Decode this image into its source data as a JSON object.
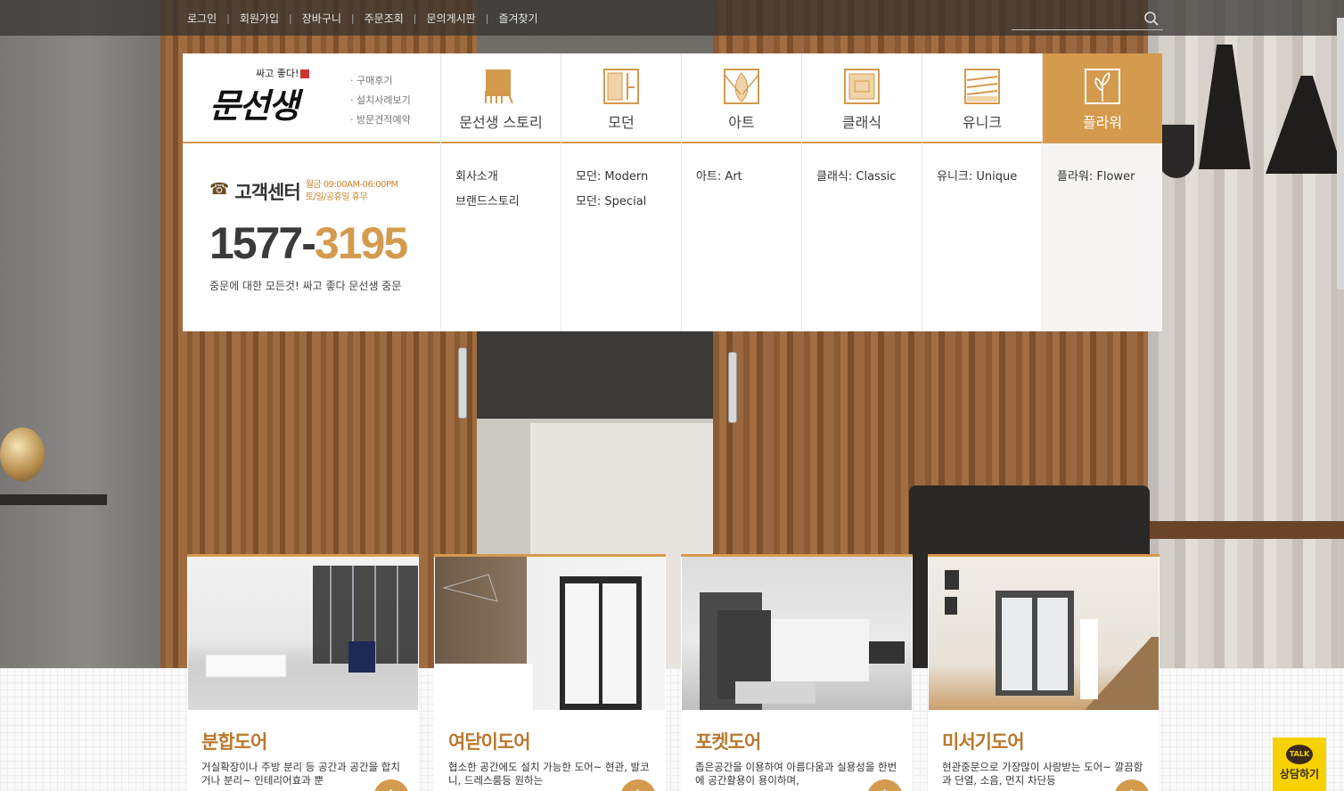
{
  "top_links": [
    "로그인",
    "회원가입",
    "장바구니",
    "주문조회",
    "문의게시판",
    "즐겨찾기"
  ],
  "search": {
    "placeholder": ""
  },
  "logo": {
    "tagline": "싸고 좋다!",
    "brand": "문선생"
  },
  "sublinks": [
    "· 구매후기",
    "· 설치사례보기",
    "· 방문견적예약"
  ],
  "menu": [
    {
      "label": "문선생 스토리",
      "icon": "story-icon"
    },
    {
      "label": "모던",
      "icon": "modern-icon"
    },
    {
      "label": "아트",
      "icon": "art-icon"
    },
    {
      "label": "클래식",
      "icon": "classic-icon"
    },
    {
      "label": "유니크",
      "icon": "unique-icon"
    },
    {
      "label": "플라워",
      "icon": "flower-icon",
      "active": true
    }
  ],
  "submenu": [
    [
      "회사소개",
      "브랜드스토리"
    ],
    [
      "모던: Modern",
      "모던: Special"
    ],
    [
      "아트: Art"
    ],
    [
      "클래식: Classic"
    ],
    [
      "유니크: Unique"
    ],
    [
      "플라워: Flower"
    ]
  ],
  "customer_center": {
    "title": "고객센터",
    "hours1": "월금 09:00AM-06:00PM",
    "hours2": "토/일/공휴일 휴무",
    "num_a": "1577-",
    "num_b": "3195",
    "slogan": "중문에 대한 모든것! 싸고 좋다 문선생 중문"
  },
  "cards": [
    {
      "title": "분합도어",
      "desc": "거실확장이나 주방 분리 등 공간과 공간을 합치거나 분리~ 인테리어효과 뿐"
    },
    {
      "title": "여닫이도어",
      "desc": "협소한 공간에도 설치 가능한 도어~ 현관, 발코니, 드레스룸등 원하는"
    },
    {
      "title": "포켓도어",
      "desc": "좁은공간을 이용하여 아름다움과 실용성을 한번에 공간활용이 용이하며,"
    },
    {
      "title": "미서기도어",
      "desc": "현관중문으로 가장많이 사랑받는 도어~ 깔끔함과 단열, 소음, 먼지 차단등"
    }
  ],
  "talk": {
    "badge": "TALK",
    "label": "상담하기"
  },
  "colors": {
    "accent": "#d49a4d",
    "kakao": "#f6d200"
  }
}
